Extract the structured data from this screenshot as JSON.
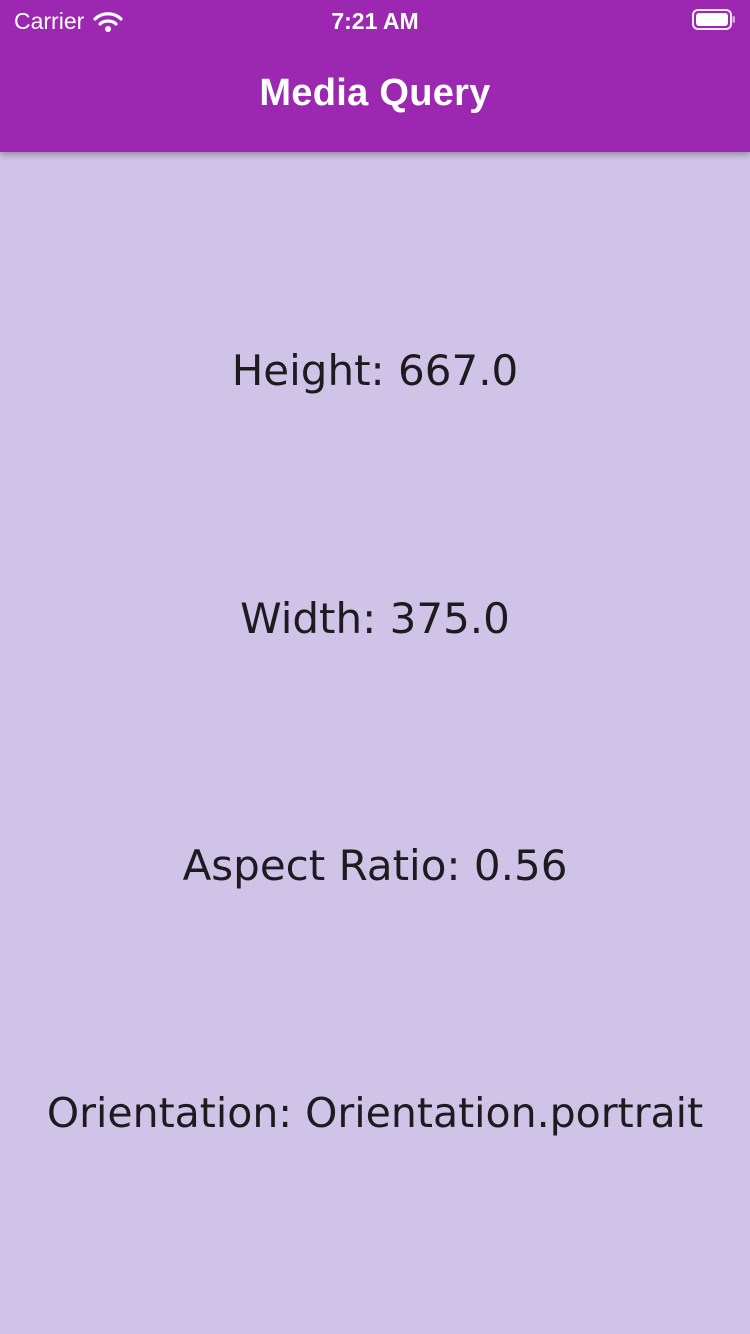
{
  "status_bar": {
    "carrier": "Carrier",
    "time": "7:21 AM",
    "icons": [
      "wifi-icon",
      "battery-icon"
    ]
  },
  "app_bar": {
    "title": "Media Query",
    "color": "#9c27b0"
  },
  "body": {
    "background": "#cfc3e7",
    "height_label": "Height: 667.0",
    "width_label": "Width: 375.0",
    "aspect_ratio_label": "Aspect Ratio: 0.56",
    "orientation_label": "Orientation: Orientation.portrait"
  }
}
